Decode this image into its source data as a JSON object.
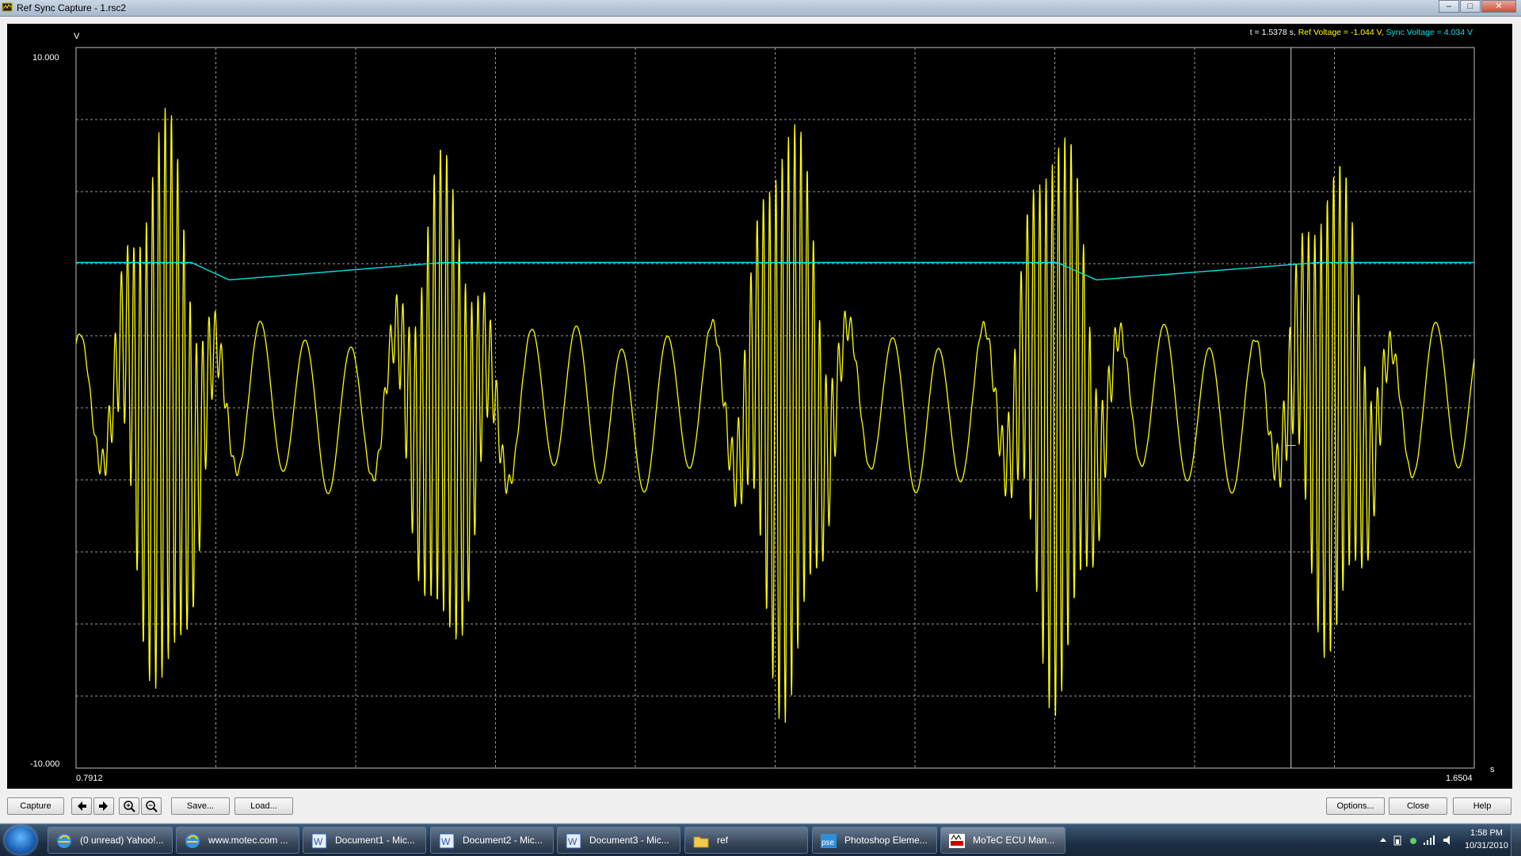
{
  "window": {
    "title": "Ref Sync Capture - 1.rsc2"
  },
  "chart_data": {
    "type": "line",
    "title": "",
    "xlabel": "s",
    "ylabel": "V",
    "xlim": [
      0.7912,
      1.6504
    ],
    "ylim": [
      -10.0,
      10.0
    ],
    "x_tick_labels": [
      "0.7912",
      "1.6504"
    ],
    "y_tick_labels": [
      "10.000",
      "-10.000"
    ],
    "grid": true,
    "cursor": {
      "t": 1.5378
    },
    "series": [
      {
        "name": "Ref Voltage",
        "color": "#ffff00",
        "description_points_x": [
          0.7912,
          0.8,
          0.82,
          0.84,
          0.86,
          0.88,
          0.9,
          0.95,
          1.0,
          1.05,
          1.1,
          1.15,
          1.2,
          1.25,
          1.3,
          1.35,
          1.4,
          1.45,
          1.5,
          1.55,
          1.6,
          1.6504
        ],
        "note_free": true,
        "tooth_bursts": [
          {
            "t_center": 0.845,
            "amplitude": 7.8
          },
          {
            "t_center": 1.018,
            "amplitude": 6.5
          },
          {
            "t_center": 1.228,
            "amplitude": 8.0
          },
          {
            "t_center": 1.394,
            "amplitude": 7.8
          },
          {
            "t_center": 1.563,
            "amplitude": 6.5
          }
        ],
        "baseline_amplitude": 2.0
      },
      {
        "name": "Sync Voltage",
        "color": "#00e5e5",
        "level": 4.034,
        "dips": [
          {
            "t_start": 0.862,
            "t_end": 1.017,
            "min": 3.55
          },
          {
            "t_start": 1.394,
            "t_end": 1.555,
            "min": 3.55
          }
        ]
      }
    ]
  },
  "readout": {
    "t_label": "t = 1.5378 s,",
    "ref_label": "Ref Voltage = -1.044 V,",
    "sync_label": "Sync Voltage = 4.034 V"
  },
  "toolbar": {
    "capture": "Capture",
    "save": "Save...",
    "load": "Load...",
    "options": "Options...",
    "close": "Close",
    "help": "Help"
  },
  "taskbar": {
    "items": [
      {
        "label": "(0 unread) Yahoo!...",
        "icon": "ie-icon"
      },
      {
        "label": "www.motec.com ...",
        "icon": "ie-icon"
      },
      {
        "label": "Document1 - Mic...",
        "icon": "word-icon"
      },
      {
        "label": "Document2 - Mic...",
        "icon": "word-icon"
      },
      {
        "label": "Document3 - Mic...",
        "icon": "word-icon"
      },
      {
        "label": "ref",
        "icon": "folder-icon"
      },
      {
        "label": "Photoshop Eleme...",
        "icon": "pse-icon"
      },
      {
        "label": "MoTeC ECU Man...",
        "icon": "motec-icon"
      }
    ],
    "time": "1:58 PM",
    "date": "10/31/2010"
  }
}
